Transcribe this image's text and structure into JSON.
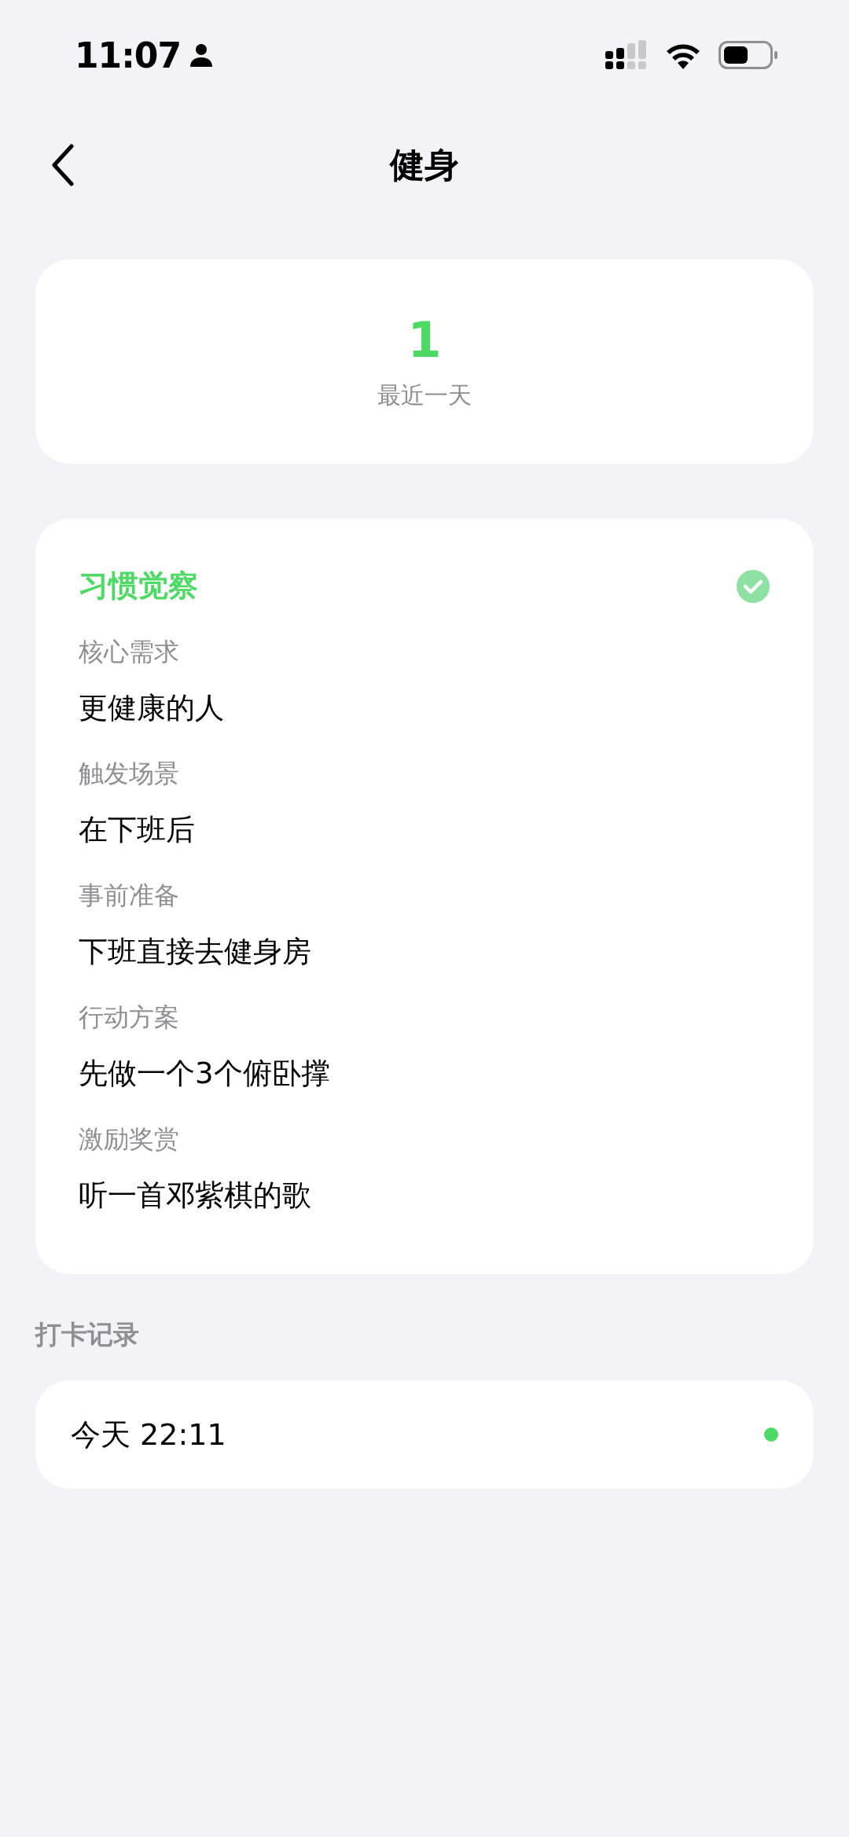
{
  "status_bar": {
    "time": "11:07"
  },
  "header": {
    "title": "健身"
  },
  "streak": {
    "value": "1",
    "label": "最近一天"
  },
  "habit": {
    "title": "习惯觉察",
    "checked": true,
    "fields": [
      {
        "label": "核心需求",
        "value": "更健康的人"
      },
      {
        "label": "触发场景",
        "value": "在下班后"
      },
      {
        "label": "事前准备",
        "value": "下班直接去健身房"
      },
      {
        "label": "行动方案",
        "value": "先做一个3个俯卧撑"
      },
      {
        "label": "激励奖赏",
        "value": "听一首邓紫棋的歌"
      }
    ]
  },
  "records": {
    "title": "打卡记录",
    "items": [
      {
        "time": "今天 22:11",
        "color": "#4cd964"
      }
    ]
  }
}
